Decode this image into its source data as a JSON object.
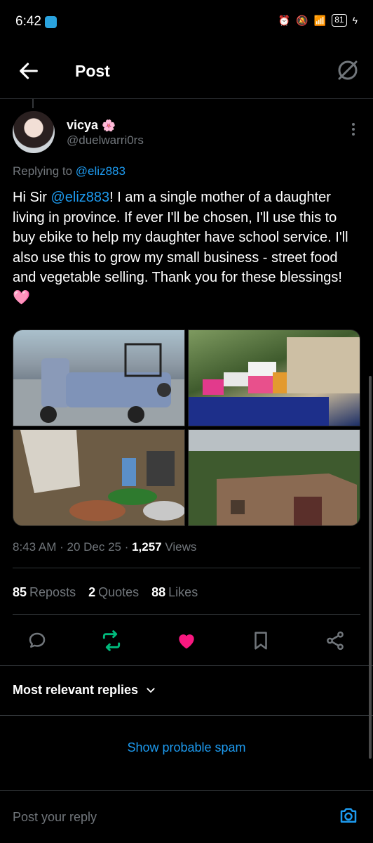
{
  "status_bar": {
    "time": "6:42",
    "battery": "81"
  },
  "header": {
    "title": "Post"
  },
  "post": {
    "author_name": "vicya",
    "author_emoji": "🌸",
    "author_handle": "@duelwarri0rs",
    "replying_prefix": "Replying to",
    "replying_to": "@eliz883",
    "text_before": "Hi Sir ",
    "mention": "@eliz883",
    "text_after": "! I am a single mother of a daughter living in province. If ever I'll be chosen, I'll use this to buy ebike to help my daughter have school service. I'll also use this to grow my small business - street food and vegetable selling. Thank you for these blessings! ",
    "text_emoji": "🩷",
    "time": "8:43 AM",
    "date": "20 Dec 25",
    "views_count": "1,257",
    "views_label": "Views"
  },
  "stats": {
    "reposts_count": "85",
    "reposts_label": "Reposts",
    "quotes_count": "2",
    "quotes_label": "Quotes",
    "likes_count": "88",
    "likes_label": "Likes"
  },
  "replies": {
    "sort_label": "Most relevant replies",
    "spam_label": "Show probable spam",
    "input_placeholder": "Post your reply"
  },
  "colors": {
    "background": "#000000",
    "link": "#1d9bf0",
    "repost_active": "#00ba7c",
    "like_active": "#f91880",
    "muted": "#71767b"
  }
}
